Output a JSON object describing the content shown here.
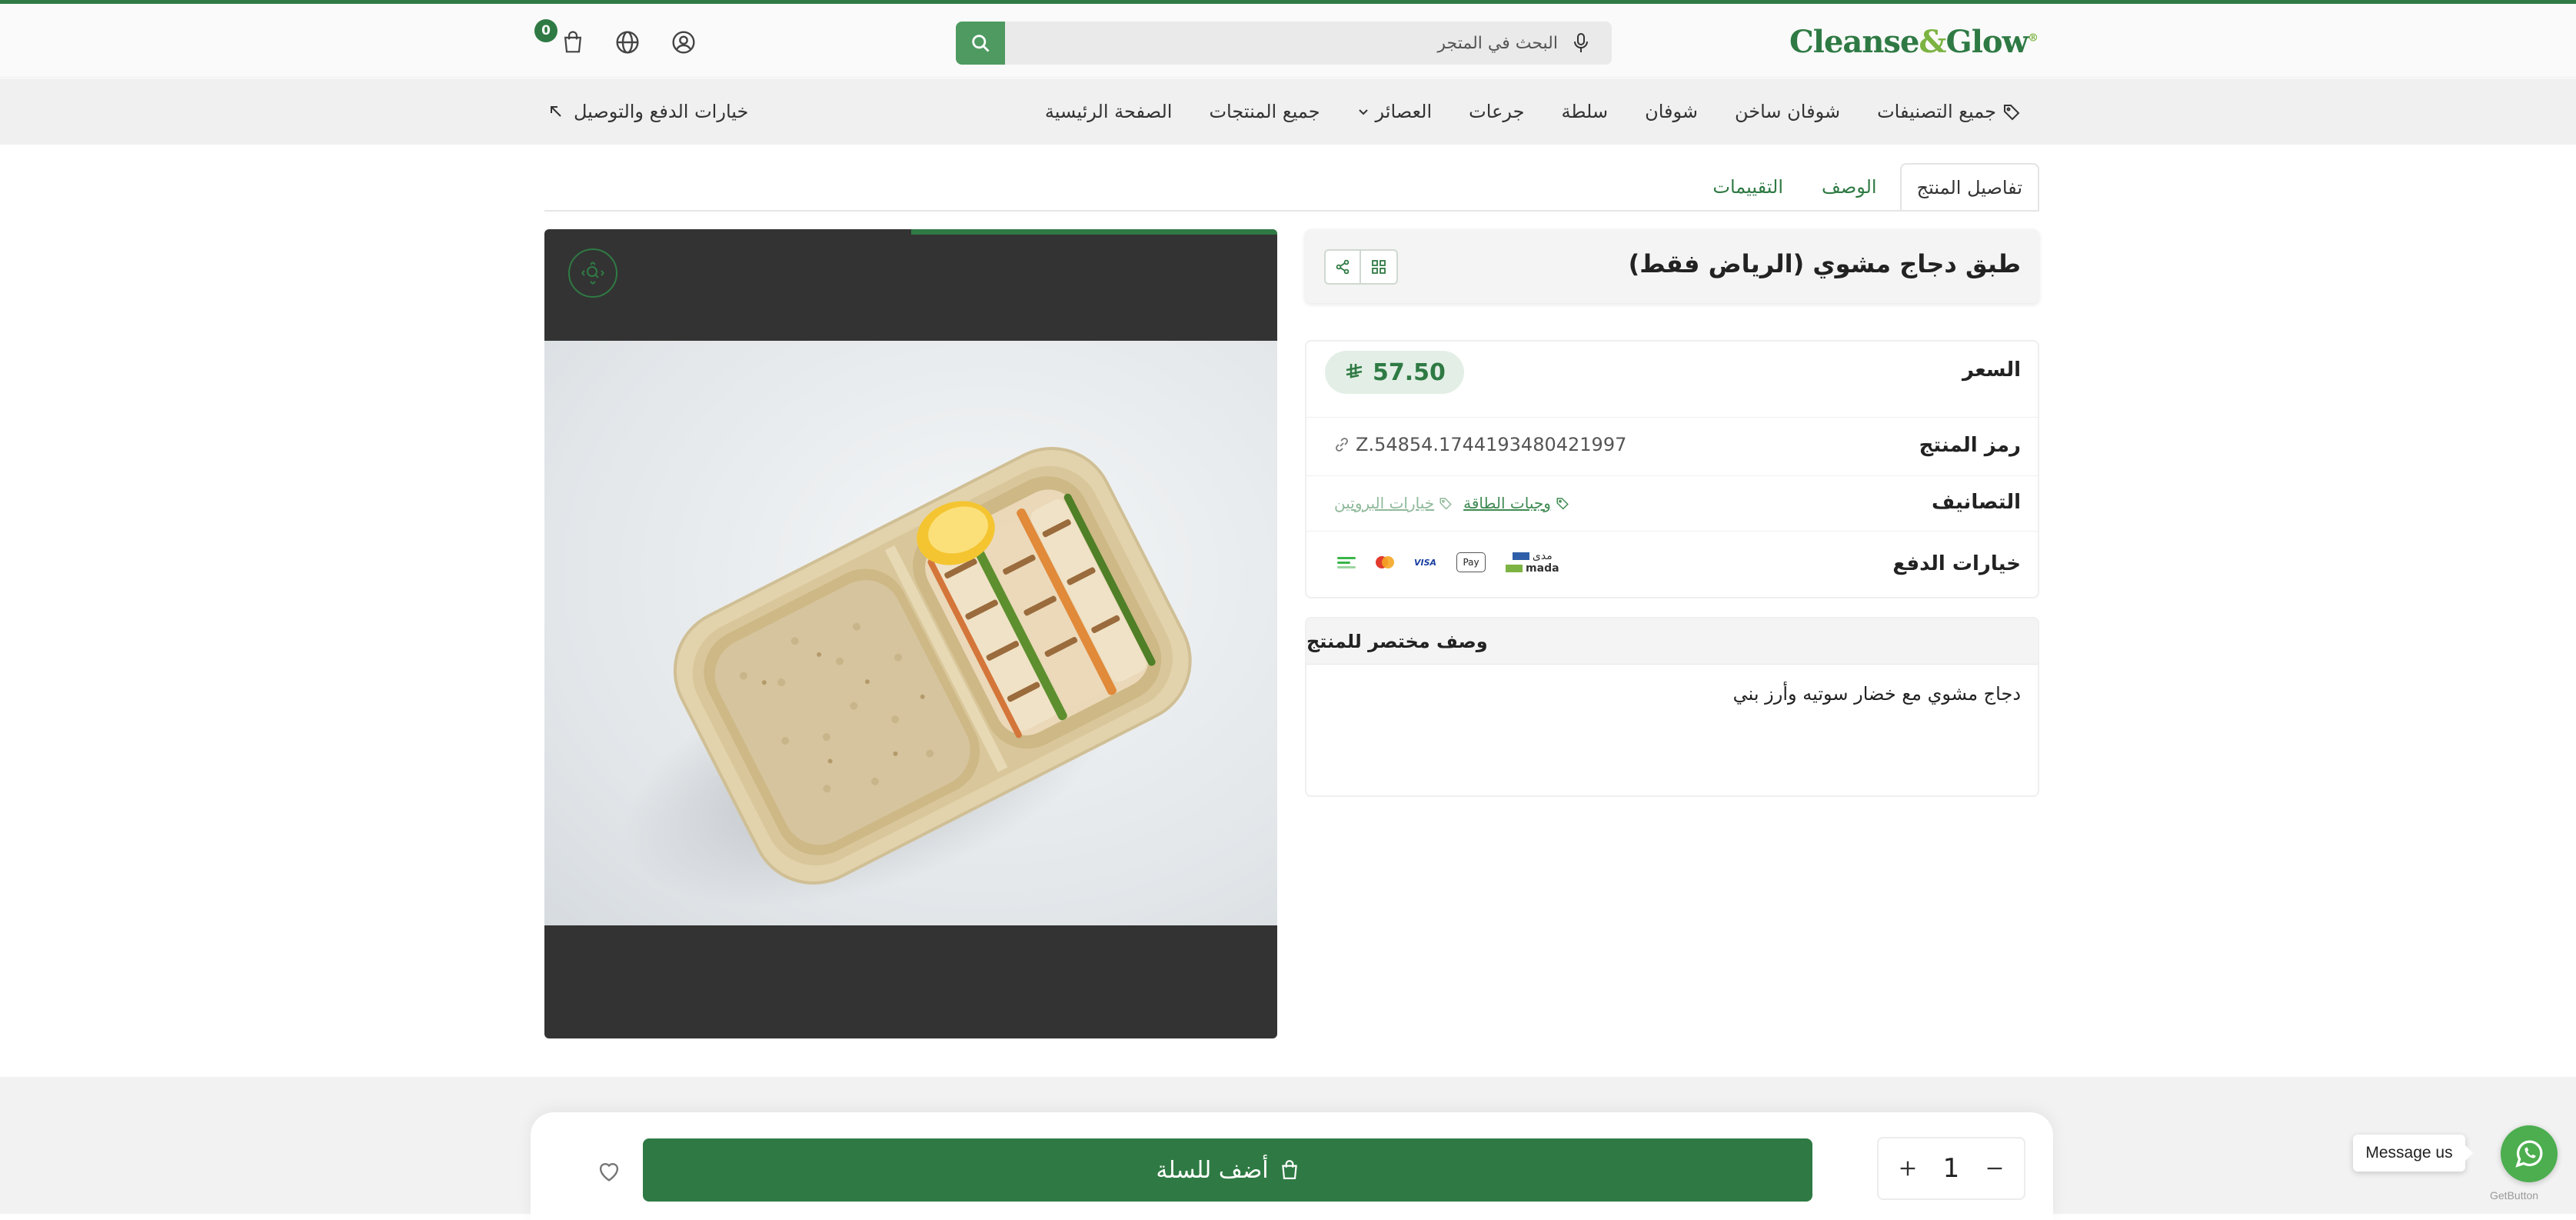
{
  "header": {
    "logo_main": "Cleanse",
    "logo_amp": "&",
    "logo_end": "Glow",
    "logo_mark": "®",
    "search_placeholder": "البحث في المتجر",
    "cart_count": "0",
    "icons": [
      "cart-icon",
      "globe-icon",
      "user-icon",
      "search-icon",
      "mic-icon"
    ]
  },
  "nav": {
    "items": [
      {
        "label": "الصفحة الرئيسية"
      },
      {
        "label": "جميع المنتجات"
      },
      {
        "label": "العصائر"
      },
      {
        "label": "جرعات"
      },
      {
        "label": "سلطة"
      },
      {
        "label": "شوفان"
      },
      {
        "label": "شوفان ساخن"
      },
      {
        "label": "جميع التصنيفات"
      }
    ],
    "payment_link": "خيارات الدفع والتوصيل"
  },
  "tabs": [
    {
      "label": "تفاصيل المنتج"
    },
    {
      "label": "الوصف"
    },
    {
      "label": "التقييمات"
    }
  ],
  "product": {
    "title": "طبق دجاج مشوي (الرياض فقط)",
    "price_label": "السعر",
    "price": "57.50",
    "sku_label": "رمز المنتج",
    "sku": "Z.54854.1744193480421997",
    "categories_label": "التصانيف",
    "categories": [
      "وجبات الطاقة",
      "خيارات البروتين"
    ],
    "payment_label": "خيارات الدفع",
    "payment_methods": [
      "mada",
      "Apple Pay",
      "VISA",
      "Mastercard",
      "Tabby"
    ],
    "mada_ar": "مدى",
    "mada_en": "mada",
    "applepay": "Pay",
    "visa": "VISA",
    "short_desc_label": "وصف مختصر للمنتج",
    "short_desc": "دجاج مشوي مع خضار سوتيه وأرز بني"
  },
  "actions": {
    "add_to_cart": "أضف للسلة",
    "quantity": "1"
  },
  "widgets": {
    "message_tooltip": "Message us",
    "getbutton": "GetButton"
  },
  "colors": {
    "brand_green": "#2f7a44",
    "accent_light_green": "#7cb342",
    "price_badge_bg": "#e3efe6",
    "whatsapp": "#4cae4f"
  }
}
